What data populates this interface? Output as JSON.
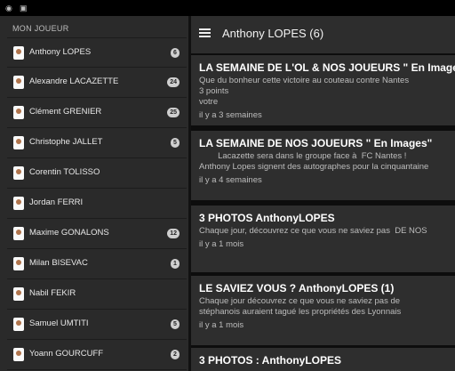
{
  "statusbar": {
    "icons": [
      "notification-icon",
      "image-icon"
    ]
  },
  "sidebar": {
    "section_title": "MON JOUEUR",
    "players": [
      {
        "name": "Anthony LOPES",
        "badge": "6"
      },
      {
        "name": "Alexandre LACAZETTE",
        "badge": "24"
      },
      {
        "name": "Clément GRENIER",
        "badge": "25"
      },
      {
        "name": "Christophe JALLET",
        "badge": "5"
      },
      {
        "name": "Corentin TOLISSO",
        "badge": ""
      },
      {
        "name": "Jordan FERRI",
        "badge": ""
      },
      {
        "name": "Maxime GONALONS",
        "badge": "12"
      },
      {
        "name": "Milan BISEVAC",
        "badge": "1"
      },
      {
        "name": "Nabil FEKIR",
        "badge": ""
      },
      {
        "name": "Samuel UMTITI",
        "badge": "5"
      },
      {
        "name": "Yoann GOURCUFF",
        "badge": "2"
      }
    ]
  },
  "appbar": {
    "title": "Anthony LOPES (6)"
  },
  "articles": [
    {
      "title": "LA SEMAINE DE L'OL & NOS JOUEURS \" En Images\"",
      "lines": [
        "Que du bonheur cette victoire au couteau contre Nantes",
        "3 points",
        "votre"
      ],
      "time": "il y a 3 semaines"
    },
    {
      "title": "LA SEMAINE DE NOS JOUEURS \" En Images\"",
      "lines": [
        "        Lacazette sera dans le groupe face à  FC Nantes !",
        "Anthony Lopes signent des autographes pour la cinquantaine"
      ],
      "time": "il y a 4 semaines"
    },
    {
      "title": "3 PHOTOS AnthonyLOPES",
      "lines": [
        "Chaque jour, découvrez ce que vous ne saviez pas  DE NOS"
      ],
      "time": "il y a 1 mois"
    },
    {
      "title": "LE SAVIEZ VOUS ? AnthonyLOPES (1)",
      "lines": [
        "Chaque jour découvrez ce que vous ne saviez pas de",
        "stéphanois auraient tagué les propriétés des Lyonnais"
      ],
      "time": "il y a 1 mois"
    },
    {
      "title": "3 PHOTOS : AnthonyLOPES",
      "lines": [],
      "time": ""
    }
  ]
}
